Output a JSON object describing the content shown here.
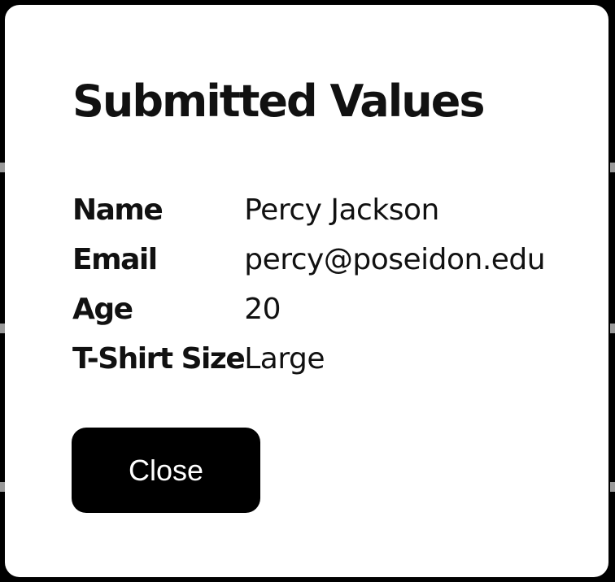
{
  "dialog": {
    "title": "Submitted Values",
    "fields": [
      {
        "label": "Name",
        "value": "Percy Jackson"
      },
      {
        "label": "Email",
        "value": "percy@poseidon.edu"
      },
      {
        "label": "Age",
        "value": "20"
      },
      {
        "label": "T-Shirt Size",
        "value": "Large"
      }
    ],
    "close_label": "Close"
  },
  "colors": {
    "backdrop": "#000000",
    "dialog_background": "#ffffff",
    "text": "#111111",
    "button_background": "#000000",
    "button_text": "#ffffff"
  }
}
